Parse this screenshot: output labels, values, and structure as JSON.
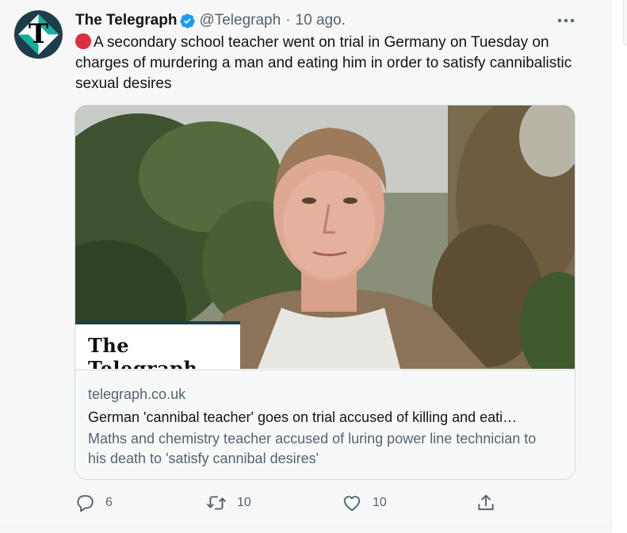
{
  "tweet": {
    "author_name": "The Telegraph",
    "handle": "@Telegraph",
    "separator": "·",
    "time": "10 ago.",
    "text": "A secondary school teacher went on trial in Germany on Tuesday on charges of murdering a man and eating him in order to satisfy cannibalistic sexual desires",
    "emoji_icon": "red-circle-icon",
    "avatar_letter": "T"
  },
  "card": {
    "image_logo": "The Telegraph",
    "domain": "telegraph.co.uk",
    "title": "German 'cannibal teacher' goes on trial accused of killing and eati…",
    "description": "Maths and chemistry teacher accused of luring power line technician to his death to 'satisfy cannibal desires'"
  },
  "actions": {
    "replies": "6",
    "retweets": "10",
    "likes": "10"
  },
  "colors": {
    "verified": "#1d9bf0",
    "secondary_text": "#536471",
    "red_circle": "#dd2e44",
    "brand_teal": "#14b09a"
  }
}
